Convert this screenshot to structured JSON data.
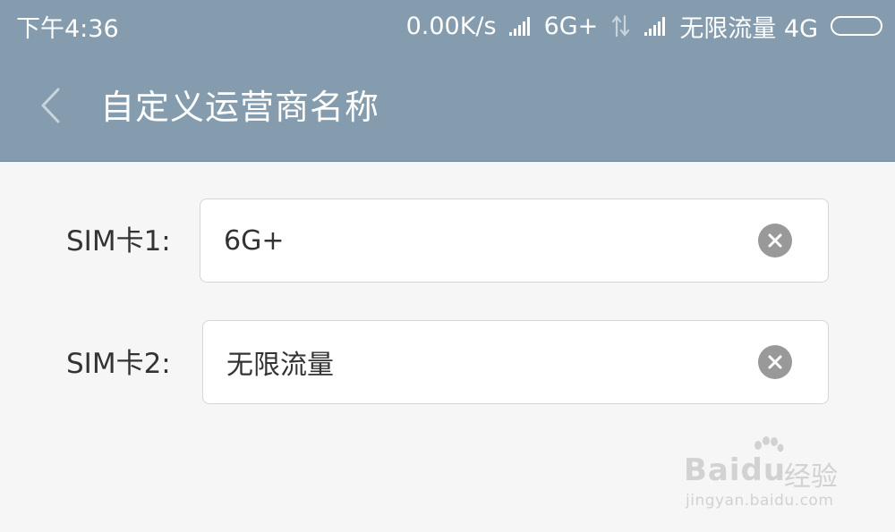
{
  "status_bar": {
    "time": "下午4:36",
    "network_speed": "0.00K/s",
    "sim1_network": "6G+",
    "sim2_network": "无限流量 4G",
    "icons": [
      "signal-icon",
      "data-arrows-icon",
      "signal-icon",
      "battery-icon"
    ]
  },
  "header": {
    "title": "自定义运营商名称",
    "back_icon": "chevron-left-icon",
    "background_color": "#849cad"
  },
  "form": {
    "sim1": {
      "label": "SIM卡1:",
      "value": "6G+",
      "clear_icon": "clear-icon"
    },
    "sim2": {
      "label": "SIM卡2:",
      "value": "无限流量",
      "clear_icon": "clear-icon"
    }
  },
  "watermark": {
    "brand": "Bai",
    "brand_suffix": "du",
    "cn": "经验",
    "url": "jingyan.baidu.com"
  }
}
